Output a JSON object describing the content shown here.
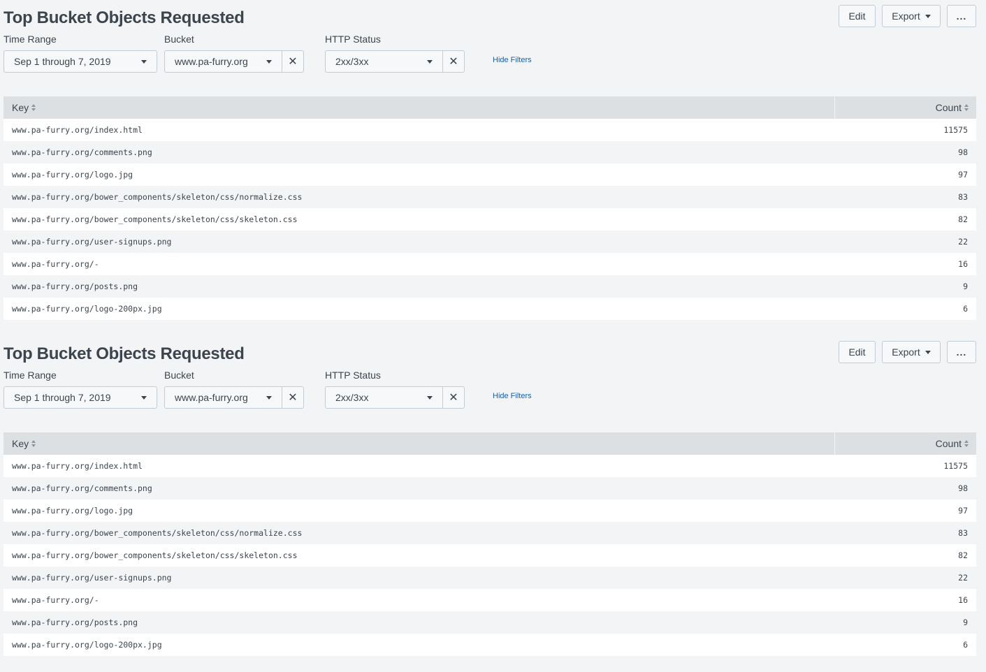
{
  "panels": [
    {
      "title": "Top Bucket Objects Requested",
      "buttons": {
        "edit": "Edit",
        "export": "Export",
        "more": "..."
      },
      "filters": {
        "time_range": {
          "label": "Time Range",
          "value": "Sep 1 through 7, 2019"
        },
        "bucket": {
          "label": "Bucket",
          "value": "www.pa-furry.org"
        },
        "http_status": {
          "label": "HTTP Status",
          "value": "2xx/3xx"
        },
        "hide_filters": "Hide Filters"
      },
      "table": {
        "columns": [
          "Key",
          "Count"
        ],
        "rows": [
          {
            "key": "www.pa-furry.org/index.html",
            "count": "11575"
          },
          {
            "key": "www.pa-furry.org/comments.png",
            "count": "98"
          },
          {
            "key": "www.pa-furry.org/logo.jpg",
            "count": "97"
          },
          {
            "key": "www.pa-furry.org/bower_components/skeleton/css/normalize.css",
            "count": "83"
          },
          {
            "key": "www.pa-furry.org/bower_components/skeleton/css/skeleton.css",
            "count": "82"
          },
          {
            "key": "www.pa-furry.org/user-signups.png",
            "count": "22"
          },
          {
            "key": "www.pa-furry.org/-",
            "count": "16"
          },
          {
            "key": "www.pa-furry.org/posts.png",
            "count": "9"
          },
          {
            "key": "www.pa-furry.org/logo-200px.jpg",
            "count": "6"
          }
        ]
      }
    },
    {
      "title": "Top Bucket Objects Requested",
      "buttons": {
        "edit": "Edit",
        "export": "Export",
        "more": "..."
      },
      "filters": {
        "time_range": {
          "label": "Time Range",
          "value": "Sep 1 through 7, 2019"
        },
        "bucket": {
          "label": "Bucket",
          "value": "www.pa-furry.org"
        },
        "http_status": {
          "label": "HTTP Status",
          "value": "2xx/3xx"
        },
        "hide_filters": "Hide Filters"
      },
      "table": {
        "columns": [
          "Key",
          "Count"
        ],
        "rows": [
          {
            "key": "www.pa-furry.org/index.html",
            "count": "11575"
          },
          {
            "key": "www.pa-furry.org/comments.png",
            "count": "98"
          },
          {
            "key": "www.pa-furry.org/logo.jpg",
            "count": "97"
          },
          {
            "key": "www.pa-furry.org/bower_components/skeleton/css/normalize.css",
            "count": "83"
          },
          {
            "key": "www.pa-furry.org/bower_components/skeleton/css/skeleton.css",
            "count": "82"
          },
          {
            "key": "www.pa-furry.org/user-signups.png",
            "count": "22"
          },
          {
            "key": "www.pa-furry.org/-",
            "count": "16"
          },
          {
            "key": "www.pa-furry.org/posts.png",
            "count": "9"
          },
          {
            "key": "www.pa-furry.org/logo-200px.jpg",
            "count": "6"
          }
        ]
      }
    }
  ]
}
